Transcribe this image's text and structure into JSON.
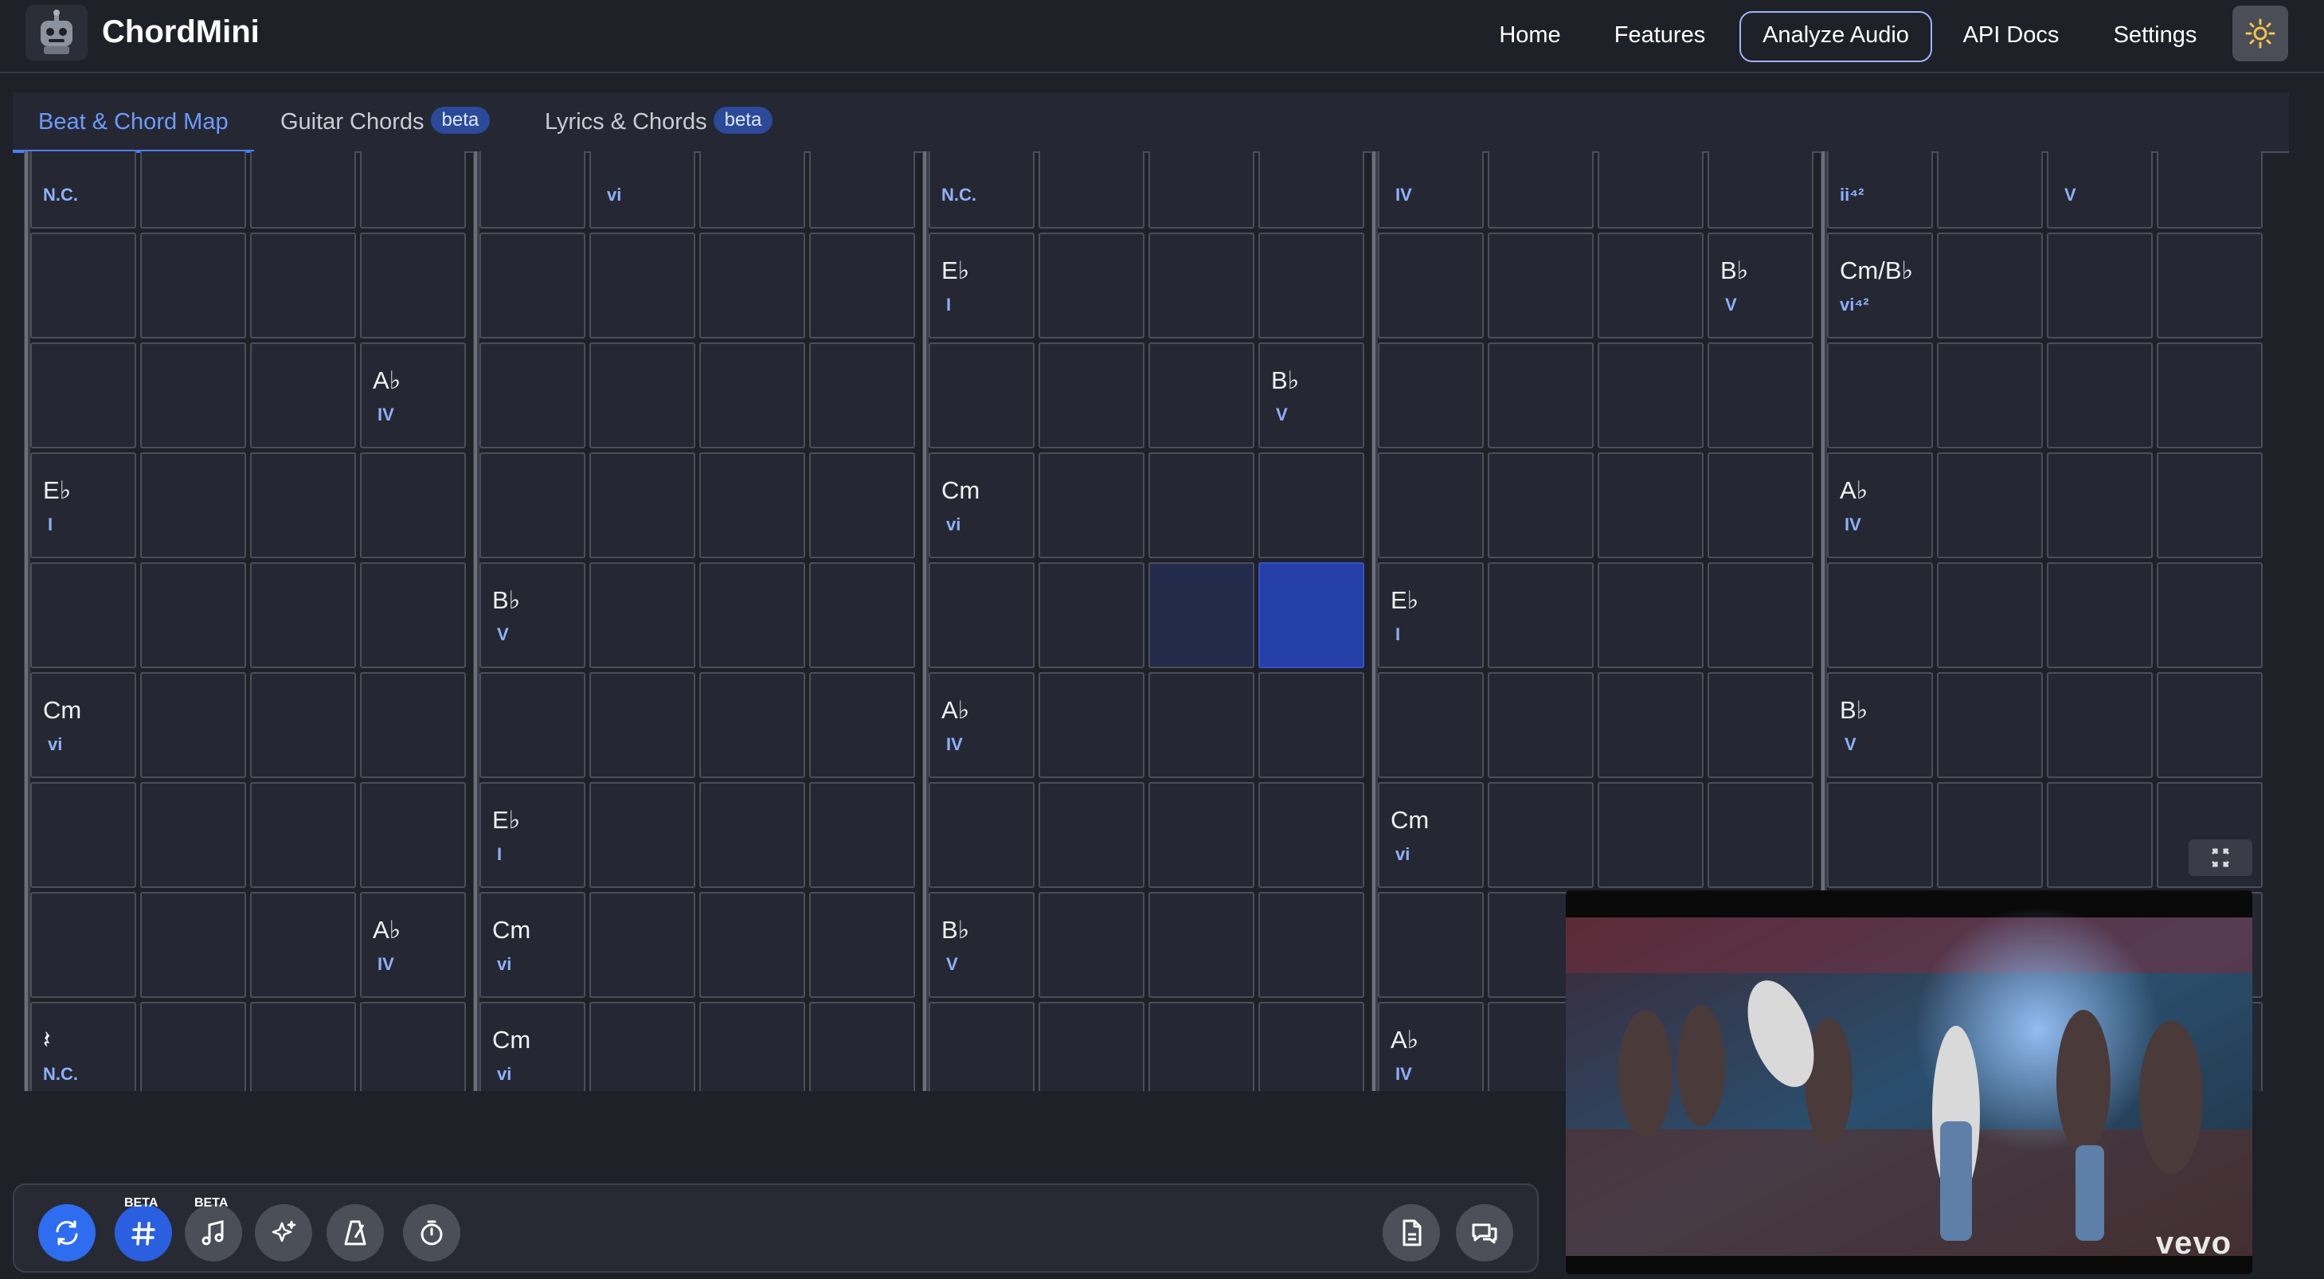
{
  "app": {
    "title": "ChordMini"
  },
  "nav": {
    "home": "Home",
    "features": "Features",
    "analyze": "Analyze Audio",
    "api_docs": "API Docs",
    "settings": "Settings"
  },
  "tabs": [
    {
      "label": "Beat & Chord Map",
      "badge": ""
    },
    {
      "label": "Guitar Chords",
      "badge": "beta"
    },
    {
      "label": "Lyrics & Chords",
      "badge": "beta"
    }
  ],
  "grid": {
    "rows": [
      [
        [
          "",
          "N.C."
        ],
        [
          "",
          ""
        ],
        [
          "",
          ""
        ],
        [
          "",
          ""
        ],
        [
          "",
          ""
        ],
        [
          "",
          "vi"
        ],
        [
          "",
          ""
        ],
        [
          "",
          ""
        ],
        [
          "",
          "N.C."
        ],
        [
          "",
          ""
        ],
        [
          "",
          ""
        ],
        [
          "",
          ""
        ],
        [
          "",
          "IV"
        ],
        [
          "",
          ""
        ],
        [
          "",
          ""
        ],
        [
          "",
          ""
        ],
        [
          "",
          "ii⁴²"
        ],
        [
          "",
          ""
        ],
        [
          "",
          "V"
        ],
        [
          "",
          ""
        ]
      ],
      [
        [
          "",
          ""
        ],
        [
          "",
          ""
        ],
        [
          "",
          ""
        ],
        [
          "",
          ""
        ],
        [
          "",
          ""
        ],
        [
          "",
          ""
        ],
        [
          "",
          ""
        ],
        [
          "",
          ""
        ],
        [
          "E♭",
          "I"
        ],
        [
          "",
          ""
        ],
        [
          "",
          ""
        ],
        [
          "",
          ""
        ],
        [
          "",
          ""
        ],
        [
          "",
          ""
        ],
        [
          "",
          ""
        ],
        [
          "B♭",
          "V"
        ],
        [
          "Cm/B♭",
          "vi⁴²"
        ],
        [
          "",
          ""
        ],
        [
          "",
          ""
        ],
        [
          "",
          ""
        ]
      ],
      [
        [
          "",
          ""
        ],
        [
          "",
          ""
        ],
        [
          "",
          ""
        ],
        [
          "A♭",
          "IV"
        ],
        [
          "",
          ""
        ],
        [
          "",
          ""
        ],
        [
          "",
          ""
        ],
        [
          "",
          ""
        ],
        [
          "",
          ""
        ],
        [
          "",
          ""
        ],
        [
          "",
          ""
        ],
        [
          "B♭",
          "V"
        ],
        [
          "",
          ""
        ],
        [
          "",
          ""
        ],
        [
          "",
          ""
        ],
        [
          "",
          ""
        ],
        [
          "",
          ""
        ],
        [
          "",
          ""
        ],
        [
          "",
          ""
        ],
        [
          "",
          ""
        ]
      ],
      [
        [
          "E♭",
          "I"
        ],
        [
          "",
          ""
        ],
        [
          "",
          ""
        ],
        [
          "",
          ""
        ],
        [
          "",
          ""
        ],
        [
          "",
          ""
        ],
        [
          "",
          ""
        ],
        [
          "",
          ""
        ],
        [
          "Cm",
          "vi"
        ],
        [
          "",
          ""
        ],
        [
          "",
          ""
        ],
        [
          "",
          ""
        ],
        [
          "",
          ""
        ],
        [
          "",
          ""
        ],
        [
          "",
          ""
        ],
        [
          "",
          ""
        ],
        [
          "A♭",
          "IV"
        ],
        [
          "",
          ""
        ],
        [
          "",
          ""
        ],
        [
          "",
          ""
        ]
      ],
      [
        [
          "",
          ""
        ],
        [
          "",
          ""
        ],
        [
          "",
          ""
        ],
        [
          "",
          ""
        ],
        [
          "B♭",
          "V"
        ],
        [
          "",
          ""
        ],
        [
          "",
          ""
        ],
        [
          "",
          ""
        ],
        [
          "",
          ""
        ],
        [
          "",
          ""
        ],
        [
          "",
          ""
        ],
        [
          "",
          ""
        ],
        [
          "E♭",
          "I"
        ],
        [
          "",
          ""
        ],
        [
          "",
          ""
        ],
        [
          "",
          ""
        ],
        [
          "",
          ""
        ],
        [
          "",
          ""
        ],
        [
          "",
          ""
        ],
        [
          "",
          ""
        ]
      ],
      [
        [
          "Cm",
          "vi"
        ],
        [
          "",
          ""
        ],
        [
          "",
          ""
        ],
        [
          "",
          ""
        ],
        [
          "",
          ""
        ],
        [
          "",
          ""
        ],
        [
          "",
          ""
        ],
        [
          "",
          ""
        ],
        [
          "A♭",
          "IV"
        ],
        [
          "",
          ""
        ],
        [
          "",
          ""
        ],
        [
          "",
          ""
        ],
        [
          "",
          ""
        ],
        [
          "",
          ""
        ],
        [
          "",
          ""
        ],
        [
          "",
          ""
        ],
        [
          "B♭",
          "V"
        ],
        [
          "",
          ""
        ],
        [
          "",
          ""
        ],
        [
          "",
          ""
        ]
      ],
      [
        [
          "",
          ""
        ],
        [
          "",
          ""
        ],
        [
          "",
          ""
        ],
        [
          "",
          ""
        ],
        [
          "E♭",
          "I"
        ],
        [
          "",
          ""
        ],
        [
          "",
          ""
        ],
        [
          "",
          ""
        ],
        [
          "",
          ""
        ],
        [
          "",
          ""
        ],
        [
          "",
          ""
        ],
        [
          "",
          ""
        ],
        [
          "Cm",
          "vi"
        ],
        [
          "",
          ""
        ],
        [
          "",
          ""
        ],
        [
          "",
          ""
        ],
        [
          "",
          ""
        ],
        [
          "",
          ""
        ],
        [
          "",
          ""
        ],
        [
          "",
          ""
        ]
      ],
      [
        [
          "",
          ""
        ],
        [
          "",
          ""
        ],
        [
          "",
          ""
        ],
        [
          "A♭",
          "IV"
        ],
        [
          "Cm",
          "vi"
        ],
        [
          "",
          ""
        ],
        [
          "",
          ""
        ],
        [
          "",
          ""
        ],
        [
          "B♭",
          "V"
        ],
        [
          "",
          ""
        ],
        [
          "",
          ""
        ],
        [
          "",
          ""
        ],
        [
          "",
          ""
        ],
        [
          "",
          ""
        ],
        [
          "",
          ""
        ],
        [
          "",
          ""
        ],
        [
          "",
          ""
        ],
        [
          "",
          ""
        ],
        [
          "",
          ""
        ],
        [
          "",
          ""
        ]
      ],
      [
        [
          "𝄽",
          "N.C."
        ],
        [
          "",
          ""
        ],
        [
          "",
          ""
        ],
        [
          "",
          ""
        ],
        [
          "Cm",
          "vi"
        ],
        [
          "",
          ""
        ],
        [
          "",
          ""
        ],
        [
          "",
          ""
        ],
        [
          "",
          ""
        ],
        [
          "",
          ""
        ],
        [
          "",
          ""
        ],
        [
          "",
          ""
        ],
        [
          "A♭",
          "IV"
        ],
        [
          "",
          ""
        ],
        [
          "",
          ""
        ],
        [
          "",
          ""
        ],
        [
          "",
          ""
        ],
        [
          "",
          ""
        ],
        [
          "",
          ""
        ],
        [
          "",
          ""
        ]
      ]
    ],
    "highlight": {
      "row": 4,
      "light_col": 10,
      "strong_col": 11
    }
  },
  "toolbar": {
    "tools": [
      {
        "icon": "refresh-icon",
        "beta": ""
      },
      {
        "icon": "hash-icon",
        "beta": "BETA"
      },
      {
        "icon": "music-note-icon",
        "beta": "BETA"
      },
      {
        "icon": "sparkles-icon",
        "beta": ""
      },
      {
        "icon": "metronome-icon",
        "beta": ""
      },
      {
        "icon": "timer-icon",
        "beta": ""
      }
    ],
    "right_tools": [
      "document-icon",
      "chat-icon"
    ]
  },
  "video": {
    "watermark": "vevo"
  },
  "colors": {
    "accent": "#4c7dff",
    "numeral": "#8fb0ff",
    "highlight": "#2540a8"
  }
}
